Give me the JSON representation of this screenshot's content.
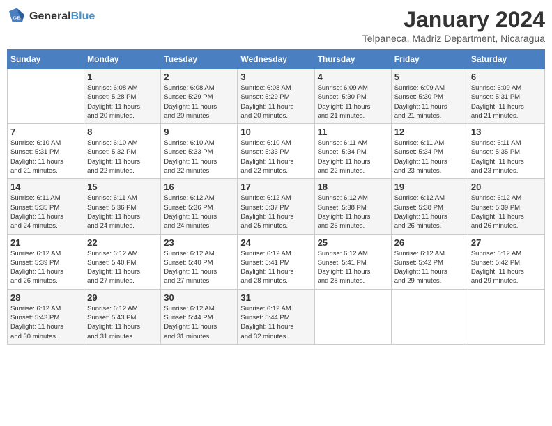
{
  "header": {
    "logo_general": "General",
    "logo_blue": "Blue",
    "month_title": "January 2024",
    "location": "Telpaneca, Madriz Department, Nicaragua"
  },
  "days_of_week": [
    "Sunday",
    "Monday",
    "Tuesday",
    "Wednesday",
    "Thursday",
    "Friday",
    "Saturday"
  ],
  "weeks": [
    [
      {
        "day": "",
        "sunrise": "",
        "sunset": "",
        "daylight": ""
      },
      {
        "day": "1",
        "sunrise": "Sunrise: 6:08 AM",
        "sunset": "Sunset: 5:28 PM",
        "daylight": "Daylight: 11 hours and 20 minutes."
      },
      {
        "day": "2",
        "sunrise": "Sunrise: 6:08 AM",
        "sunset": "Sunset: 5:29 PM",
        "daylight": "Daylight: 11 hours and 20 minutes."
      },
      {
        "day": "3",
        "sunrise": "Sunrise: 6:08 AM",
        "sunset": "Sunset: 5:29 PM",
        "daylight": "Daylight: 11 hours and 20 minutes."
      },
      {
        "day": "4",
        "sunrise": "Sunrise: 6:09 AM",
        "sunset": "Sunset: 5:30 PM",
        "daylight": "Daylight: 11 hours and 21 minutes."
      },
      {
        "day": "5",
        "sunrise": "Sunrise: 6:09 AM",
        "sunset": "Sunset: 5:30 PM",
        "daylight": "Daylight: 11 hours and 21 minutes."
      },
      {
        "day": "6",
        "sunrise": "Sunrise: 6:09 AM",
        "sunset": "Sunset: 5:31 PM",
        "daylight": "Daylight: 11 hours and 21 minutes."
      }
    ],
    [
      {
        "day": "7",
        "sunrise": "Sunrise: 6:10 AM",
        "sunset": "Sunset: 5:31 PM",
        "daylight": "Daylight: 11 hours and 21 minutes."
      },
      {
        "day": "8",
        "sunrise": "Sunrise: 6:10 AM",
        "sunset": "Sunset: 5:32 PM",
        "daylight": "Daylight: 11 hours and 22 minutes."
      },
      {
        "day": "9",
        "sunrise": "Sunrise: 6:10 AM",
        "sunset": "Sunset: 5:33 PM",
        "daylight": "Daylight: 11 hours and 22 minutes."
      },
      {
        "day": "10",
        "sunrise": "Sunrise: 6:10 AM",
        "sunset": "Sunset: 5:33 PM",
        "daylight": "Daylight: 11 hours and 22 minutes."
      },
      {
        "day": "11",
        "sunrise": "Sunrise: 6:11 AM",
        "sunset": "Sunset: 5:34 PM",
        "daylight": "Daylight: 11 hours and 22 minutes."
      },
      {
        "day": "12",
        "sunrise": "Sunrise: 6:11 AM",
        "sunset": "Sunset: 5:34 PM",
        "daylight": "Daylight: 11 hours and 23 minutes."
      },
      {
        "day": "13",
        "sunrise": "Sunrise: 6:11 AM",
        "sunset": "Sunset: 5:35 PM",
        "daylight": "Daylight: 11 hours and 23 minutes."
      }
    ],
    [
      {
        "day": "14",
        "sunrise": "Sunrise: 6:11 AM",
        "sunset": "Sunset: 5:35 PM",
        "daylight": "Daylight: 11 hours and 24 minutes."
      },
      {
        "day": "15",
        "sunrise": "Sunrise: 6:11 AM",
        "sunset": "Sunset: 5:36 PM",
        "daylight": "Daylight: 11 hours and 24 minutes."
      },
      {
        "day": "16",
        "sunrise": "Sunrise: 6:12 AM",
        "sunset": "Sunset: 5:36 PM",
        "daylight": "Daylight: 11 hours and 24 minutes."
      },
      {
        "day": "17",
        "sunrise": "Sunrise: 6:12 AM",
        "sunset": "Sunset: 5:37 PM",
        "daylight": "Daylight: 11 hours and 25 minutes."
      },
      {
        "day": "18",
        "sunrise": "Sunrise: 6:12 AM",
        "sunset": "Sunset: 5:38 PM",
        "daylight": "Daylight: 11 hours and 25 minutes."
      },
      {
        "day": "19",
        "sunrise": "Sunrise: 6:12 AM",
        "sunset": "Sunset: 5:38 PM",
        "daylight": "Daylight: 11 hours and 26 minutes."
      },
      {
        "day": "20",
        "sunrise": "Sunrise: 6:12 AM",
        "sunset": "Sunset: 5:39 PM",
        "daylight": "Daylight: 11 hours and 26 minutes."
      }
    ],
    [
      {
        "day": "21",
        "sunrise": "Sunrise: 6:12 AM",
        "sunset": "Sunset: 5:39 PM",
        "daylight": "Daylight: 11 hours and 26 minutes."
      },
      {
        "day": "22",
        "sunrise": "Sunrise: 6:12 AM",
        "sunset": "Sunset: 5:40 PM",
        "daylight": "Daylight: 11 hours and 27 minutes."
      },
      {
        "day": "23",
        "sunrise": "Sunrise: 6:12 AM",
        "sunset": "Sunset: 5:40 PM",
        "daylight": "Daylight: 11 hours and 27 minutes."
      },
      {
        "day": "24",
        "sunrise": "Sunrise: 6:12 AM",
        "sunset": "Sunset: 5:41 PM",
        "daylight": "Daylight: 11 hours and 28 minutes."
      },
      {
        "day": "25",
        "sunrise": "Sunrise: 6:12 AM",
        "sunset": "Sunset: 5:41 PM",
        "daylight": "Daylight: 11 hours and 28 minutes."
      },
      {
        "day": "26",
        "sunrise": "Sunrise: 6:12 AM",
        "sunset": "Sunset: 5:42 PM",
        "daylight": "Daylight: 11 hours and 29 minutes."
      },
      {
        "day": "27",
        "sunrise": "Sunrise: 6:12 AM",
        "sunset": "Sunset: 5:42 PM",
        "daylight": "Daylight: 11 hours and 29 minutes."
      }
    ],
    [
      {
        "day": "28",
        "sunrise": "Sunrise: 6:12 AM",
        "sunset": "Sunset: 5:43 PM",
        "daylight": "Daylight: 11 hours and 30 minutes."
      },
      {
        "day": "29",
        "sunrise": "Sunrise: 6:12 AM",
        "sunset": "Sunset: 5:43 PM",
        "daylight": "Daylight: 11 hours and 31 minutes."
      },
      {
        "day": "30",
        "sunrise": "Sunrise: 6:12 AM",
        "sunset": "Sunset: 5:44 PM",
        "daylight": "Daylight: 11 hours and 31 minutes."
      },
      {
        "day": "31",
        "sunrise": "Sunrise: 6:12 AM",
        "sunset": "Sunset: 5:44 PM",
        "daylight": "Daylight: 11 hours and 32 minutes."
      },
      {
        "day": "",
        "sunrise": "",
        "sunset": "",
        "daylight": ""
      },
      {
        "day": "",
        "sunrise": "",
        "sunset": "",
        "daylight": ""
      },
      {
        "day": "",
        "sunrise": "",
        "sunset": "",
        "daylight": ""
      }
    ]
  ]
}
